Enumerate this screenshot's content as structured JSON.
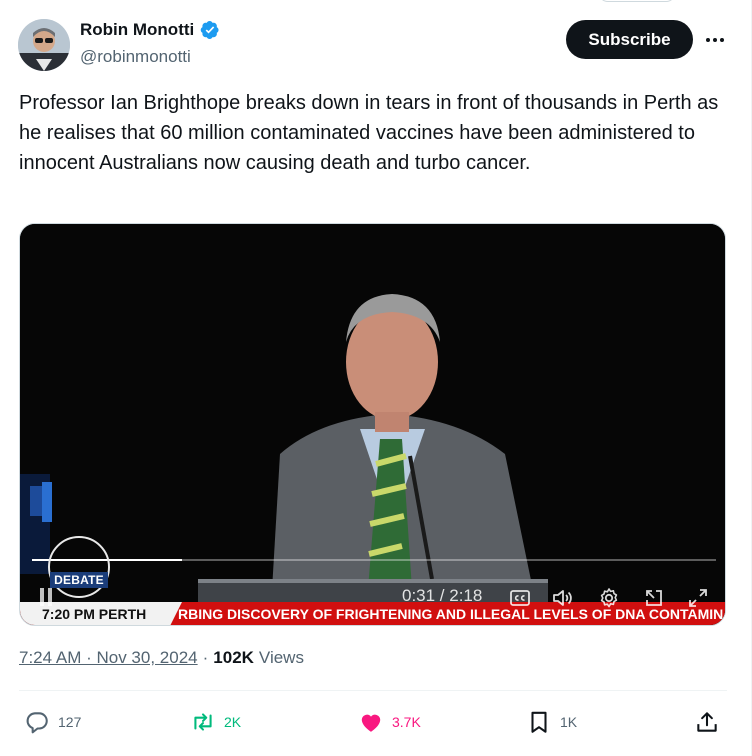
{
  "author": {
    "display_name": "Robin Monotti",
    "handle": "@robinmonotti",
    "verified": true
  },
  "header": {
    "subscribe_label": "Subscribe",
    "more_icon": "more-horizontal-icon"
  },
  "tweet": {
    "text": "Professor Ian Brighthope breaks down in tears in front of thousands in Perth as he realises that 60 million contaminated vaccines have been administered to innocent Australians now causing death and turbo cancer."
  },
  "video": {
    "logo_text": "DEBATE",
    "ticker_time": "7:20 PM PERTH",
    "ticker_text": "RBING DISCOVERY OF FRIGHTENING AND ILLEGAL LEVELS OF DNA CONTAMINATIO",
    "time_display": "0:31 / 2:18",
    "progress_fraction": 0.22,
    "controls": [
      "pause-icon",
      "captions-icon",
      "volume-icon",
      "settings-icon",
      "pip-icon",
      "fullscreen-icon"
    ]
  },
  "meta": {
    "timestamp": "7:24 AM · Nov 30, 2024",
    "views_count": "102K",
    "views_label": "Views"
  },
  "actions": {
    "replies": "127",
    "reposts": "2K",
    "likes": "3.7K",
    "bookmarks": "1K"
  },
  "colors": {
    "text_primary": "#0f1419",
    "text_secondary": "#536471",
    "verified_blue": "#1d9bf0",
    "repost_green": "#00ba7c",
    "like_pink": "#f91880",
    "ticker_red": "#d10f0f"
  }
}
